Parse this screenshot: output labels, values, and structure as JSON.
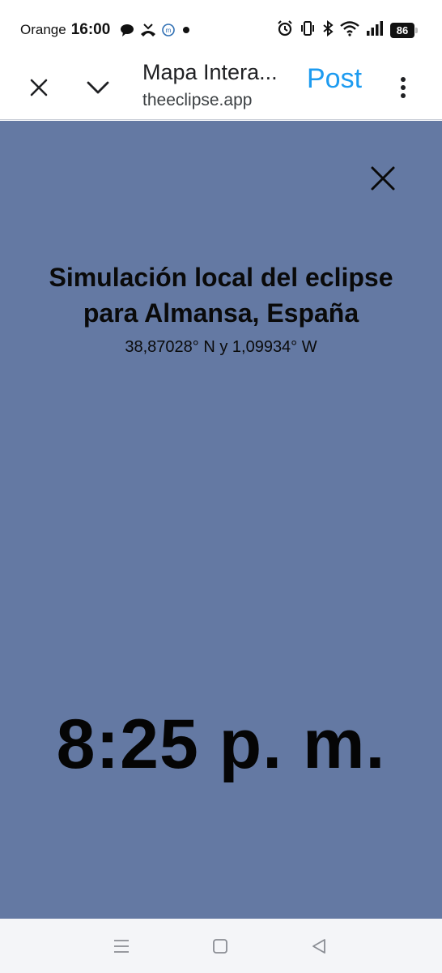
{
  "status_bar": {
    "carrier": "Orange",
    "time": "16:00",
    "battery": "86",
    "left_icons": [
      "chat-bubble-icon",
      "missed-call-icon",
      "messenger-app-icon",
      "notification-dot-icon"
    ],
    "right_icons": [
      "alarm-icon",
      "vibrate-icon",
      "bluetooth-icon",
      "wifi-icon",
      "signal-icon",
      "battery-icon"
    ]
  },
  "browser": {
    "title": "Mapa Intera...",
    "url": "theeclipse.app",
    "post_label": "Post",
    "icons": [
      "close-icon",
      "chevron-down-icon",
      "more-vert-icon"
    ],
    "accent_color": "#1d9bf0"
  },
  "simulation": {
    "heading_line1": "Simulación local del eclipse",
    "heading_line2": "para Almansa, España",
    "coordinates": "38,87028° N y 1,09934° W",
    "time": "8:25 p. m.",
    "background_color": "#6479a3",
    "sun_color": "#f8f5eb"
  },
  "nav_bar": {
    "icons": [
      "menu-icon",
      "home-icon",
      "back-icon"
    ]
  }
}
